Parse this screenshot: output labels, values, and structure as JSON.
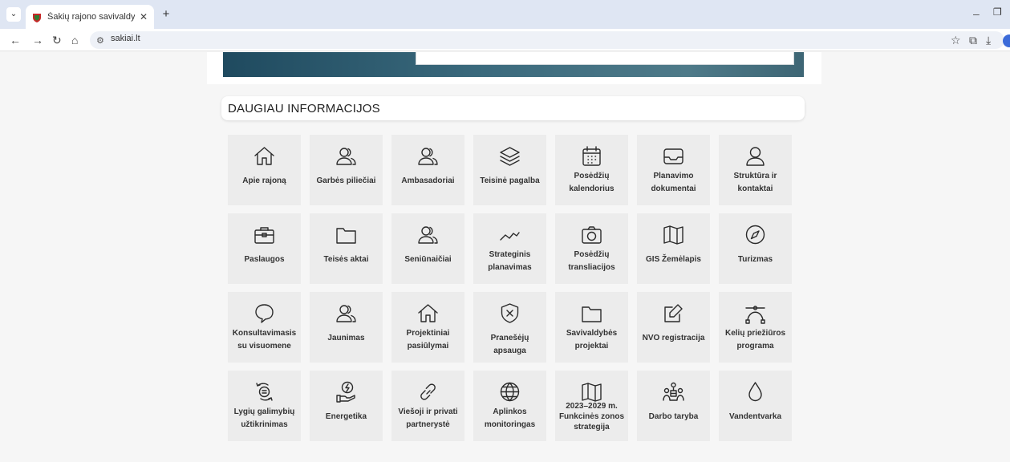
{
  "browser": {
    "tab_title": "Šakių rajono savivaldybė - Prad",
    "url": "sakiai.lt"
  },
  "section": {
    "title": "DAUGIAU INFORMACIJOS"
  },
  "tiles": [
    {
      "label": "Apie rajoną",
      "icon": "home-icon"
    },
    {
      "label": "Garbės piliečiai",
      "icon": "users-icon"
    },
    {
      "label": "Ambasadoriai",
      "icon": "users-icon"
    },
    {
      "label": "Teisinė pagalba",
      "icon": "layers-icon"
    },
    {
      "label": "Posėdžių kalendorius",
      "icon": "calendar-icon"
    },
    {
      "label": "Planavimo dokumentai",
      "icon": "inbox-icon"
    },
    {
      "label": "Struktūra ir kontaktai",
      "icon": "user-icon"
    },
    {
      "label": "Paslaugos",
      "icon": "briefcase-icon"
    },
    {
      "label": "Teisės aktai",
      "icon": "folder-icon"
    },
    {
      "label": "Seniūnaičiai",
      "icon": "users-icon"
    },
    {
      "label": "Strateginis planavimas",
      "icon": "trend-icon"
    },
    {
      "label": "Posėdžių transliacijos",
      "icon": "camera-icon"
    },
    {
      "label": "GIS Žemėlapis",
      "icon": "map-icon"
    },
    {
      "label": "Turizmas",
      "icon": "compass-icon"
    },
    {
      "label": "Konsultavimasis su visuomene",
      "icon": "chat-icon"
    },
    {
      "label": "Jaunimas",
      "icon": "users-icon"
    },
    {
      "label": "Projektiniai pasiūlymai",
      "icon": "home-icon"
    },
    {
      "label": "Pranešėjų apsauga",
      "icon": "shield-icon"
    },
    {
      "label": "Savivaldybės projektai",
      "icon": "folder-icon"
    },
    {
      "label": "NVO registracija",
      "icon": "edit-icon"
    },
    {
      "label": "Kelių priežiūros programa",
      "icon": "bezier-icon"
    },
    {
      "label": "Lygių galimybių užtikrinimas",
      "icon": "equality-icon"
    },
    {
      "label": "Energetika",
      "icon": "energy-icon"
    },
    {
      "label": "Viešoji ir privati partnerystė",
      "icon": "link-icon"
    },
    {
      "label": "Aplinkos monitoringas",
      "icon": "globe-icon"
    },
    {
      "label": "2023–2029 m. Funkcinės zonos strategija",
      "icon": "map-icon"
    },
    {
      "label": "Darbo taryba",
      "icon": "council-icon"
    },
    {
      "label": "Vandentvarka",
      "icon": "drop-icon"
    }
  ]
}
